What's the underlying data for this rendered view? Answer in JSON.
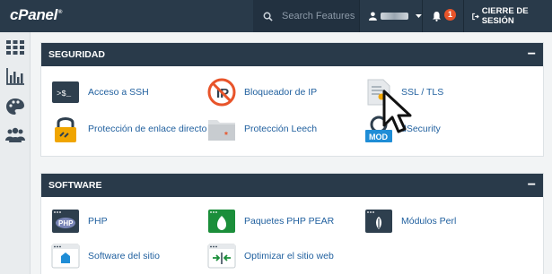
{
  "brand": "cPanel",
  "header": {
    "search_placeholder": "Search Features",
    "notifications_count": "1",
    "logout_label": "CIERRE DE SESIÓN"
  },
  "sidebar": {
    "items": [
      "grid-icon",
      "chart-icon",
      "palette-icon",
      "users-icon"
    ]
  },
  "sections": [
    {
      "title": "SEGURIDAD",
      "collapse": "−",
      "items": [
        {
          "label": "Acceso a SSH",
          "icon": "terminal-icon"
        },
        {
          "label": "Bloqueador de IP",
          "icon": "ip-blocker-icon"
        },
        {
          "label": "SSL / TLS",
          "icon": "certificate-icon"
        },
        {
          "label": "Protección de enlace directo",
          "icon": "link-lock-icon"
        },
        {
          "label": "Protección Leech",
          "icon": "folder-leech-icon"
        },
        {
          "label": "ModSecurity",
          "visible_label": "dSecurity",
          "icon": "mod-icon",
          "icon_text": "MOD"
        }
      ]
    },
    {
      "title": "SOFTWARE",
      "collapse": "−",
      "items": [
        {
          "label": "PHP",
          "icon": "php-icon",
          "icon_text": "PHP"
        },
        {
          "label": "Paquetes PHP PEAR",
          "icon": "php-pear-icon"
        },
        {
          "label": "Módulos Perl",
          "icon": "perl-icon"
        },
        {
          "label": "Software del sitio",
          "icon": "site-software-icon"
        },
        {
          "label": "Optimizar el sitio web",
          "icon": "optimize-icon"
        }
      ]
    }
  ],
  "colors": {
    "topbar": "#293a4a",
    "link": "#1f5f9e",
    "badge": "#e8542a"
  }
}
